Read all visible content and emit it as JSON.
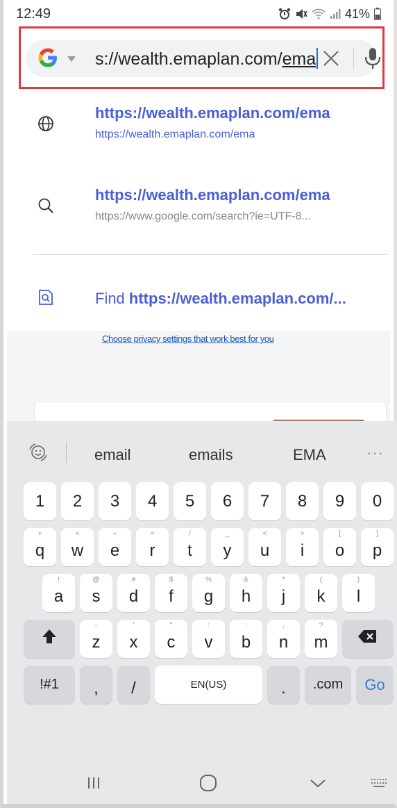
{
  "status_bar": {
    "time": "12:49",
    "battery": "41%",
    "icons": [
      "alarm-icon",
      "mute-icon",
      "wifi-icon",
      "signal-icon",
      "battery-icon"
    ]
  },
  "url_bar": {
    "text_before_selection": "s://wealth.emaplan.com/",
    "text_selected": "ema",
    "engine_icon": "google-logo",
    "clear_icon": "close-icon",
    "mic_icon": "microphone-icon",
    "highlight_color": "#e0393e"
  },
  "suggestions": [
    {
      "icon": "globe-icon",
      "title": "https://wealth.emaplan.com/ema",
      "subtitle": "https://wealth.emaplan.com/ema"
    },
    {
      "icon": "search-icon",
      "title": "https://wealth.emaplan.com/ema",
      "subtitle": "https://www.google.com/search?ie=UTF-8..."
    }
  ],
  "find_in_page": {
    "icon": "find-in-page-icon",
    "prefix": "Find",
    "query": "https://wealth.emaplan.com/..."
  },
  "background_page": {
    "privacy_link": "Choose privacy settings that work best for you"
  },
  "keyboard": {
    "predictions": [
      "email",
      "emails",
      "EMA"
    ],
    "more": "···",
    "number_row": [
      "1",
      "2",
      "3",
      "4",
      "5",
      "6",
      "7",
      "8",
      "9",
      "0"
    ],
    "row1": [
      {
        "key": "q",
        "hint": "+"
      },
      {
        "key": "w",
        "hint": "×"
      },
      {
        "key": "e",
        "hint": "÷"
      },
      {
        "key": "r",
        "hint": "="
      },
      {
        "key": "t",
        "hint": "/"
      },
      {
        "key": "y",
        "hint": "_"
      },
      {
        "key": "u",
        "hint": "<"
      },
      {
        "key": "i",
        "hint": ">"
      },
      {
        "key": "o",
        "hint": "["
      },
      {
        "key": "p",
        "hint": "]"
      }
    ],
    "row2": [
      {
        "key": "a",
        "hint": "!"
      },
      {
        "key": "s",
        "hint": "@"
      },
      {
        "key": "d",
        "hint": "#"
      },
      {
        "key": "f",
        "hint": "$"
      },
      {
        "key": "g",
        "hint": "%"
      },
      {
        "key": "h",
        "hint": "&"
      },
      {
        "key": "j",
        "hint": "*"
      },
      {
        "key": "k",
        "hint": "("
      },
      {
        "key": "l",
        "hint": ")"
      }
    ],
    "row3": [
      {
        "key": "z",
        "hint": "-"
      },
      {
        "key": "x",
        "hint": "'"
      },
      {
        "key": "c",
        "hint": "\""
      },
      {
        "key": "v",
        "hint": ":"
      },
      {
        "key": "b",
        "hint": ";"
      },
      {
        "key": "n",
        "hint": ","
      },
      {
        "key": "m",
        "hint": "?"
      }
    ],
    "symbols_label": "!#1",
    "comma": ",",
    "slash": "/",
    "space_label": "EN(US)",
    "period": ".",
    "dotcom": ".com",
    "go_label": "Go"
  },
  "nav_bar": {
    "icons": [
      "recent-apps-icon",
      "home-icon",
      "back-icon",
      "keyboard-icon"
    ]
  }
}
